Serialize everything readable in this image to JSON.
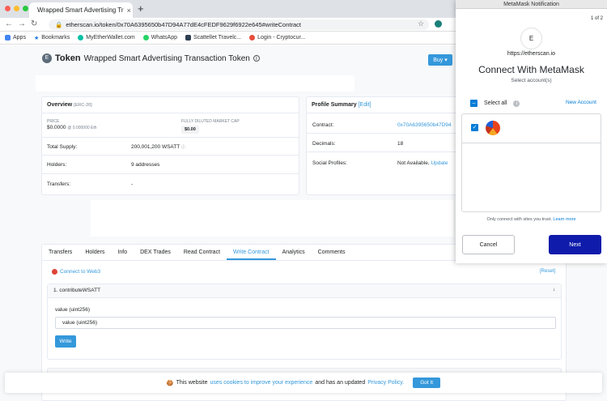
{
  "browser": {
    "tab_title": "Wrapped Smart Advertising Tr",
    "url": "etherscan.io/token/0x70A6395650b47D94A77dE4cFEDF9629f6922e645#writeContract",
    "bookmarks": [
      "Apps",
      "Bookmarks",
      "MyEtherWallet.com",
      "WhatsApp",
      "Scattellet Travelc...",
      "Login - Cryptocur..."
    ]
  },
  "token": {
    "label": "Token",
    "name": "Wrapped Smart Advertising Transaction Token",
    "buy_label": "Buy"
  },
  "overview": {
    "title": "Overview",
    "tag": "[ERC-20]",
    "price_label": "PRICE",
    "price": "$0.0000",
    "price_eth": "@ 0.000000 Eth",
    "mcap_label": "FULLY DILUTED MARKET CAP",
    "mcap": "$0.00",
    "supply_label": "Total Supply:",
    "supply": "200,001,200 WSATT",
    "holders_label": "Holders:",
    "holders": "9 addresses",
    "transfers_label": "Transfers:",
    "transfers": "-"
  },
  "profile": {
    "title": "Profile Summary",
    "edit": "[Edit]",
    "contract_label": "Contract:",
    "contract": "0x70A6395650b47D94",
    "decimals_label": "Decimals:",
    "decimals": "18",
    "social_label": "Social Profiles:",
    "social": "Not Available,",
    "update": "Update"
  },
  "tabs": [
    "Transfers",
    "Holders",
    "Info",
    "DEX Trades",
    "Read Contract",
    "Write Contract",
    "Analytics",
    "Comments"
  ],
  "active_tab": "Write Contract",
  "contract": {
    "connect": "Connect to Web3",
    "reset": "[Reset]",
    "fn_title": "1. contributeWSATT",
    "value_label": "value (uint256)",
    "value_placeholder": "value (uint256)",
    "write": "Write"
  },
  "cookie": {
    "text1": "This website",
    "link1": "uses cookies to improve your experience",
    "text2": "and has an updated",
    "link2": "Privacy Policy.",
    "button": "Got It"
  },
  "metamask": {
    "title": "MetaMask Notification",
    "page": "1 of 2",
    "logo_letter": "E",
    "site": "https://etherscan.io",
    "heading": "Connect With MetaMask",
    "subheading": "Select account(s)",
    "select_all": "Select all",
    "new_account": "New Account",
    "trust_text": "Only connect with sites you trust.",
    "learn_more": "Learn more",
    "cancel": "Cancel",
    "next": "Next"
  },
  "colors": {
    "accent": "#3498db",
    "metamask_blue": "#037dd6",
    "next_button": "#0f1bab"
  }
}
